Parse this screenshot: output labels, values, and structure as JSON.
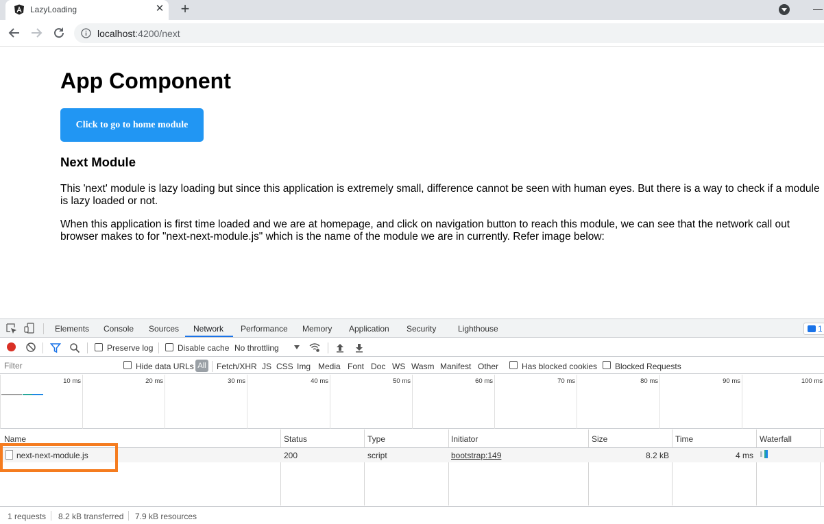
{
  "browser": {
    "tab_title": "LazyLoading",
    "url_host": "localhost",
    "url_rest": ":4200/next"
  },
  "page": {
    "title": "App Component",
    "home_button": "Click to go to home module",
    "section_heading": "Next Module",
    "paragraph_1": "This 'next' module is lazy loading but since this application is extremely small, difference cannot be seen with human eyes. But there is a way to check if a module is lazy loaded or not.",
    "paragraph_2": "When this application is first time loaded and we are at homepage, and click on navigation button to reach this module, we can see that the network call out browser makes to for \"next-next-module.js\" which is the name of the module we are in currently. Refer image below:"
  },
  "devtools": {
    "tabs": [
      "Elements",
      "Console",
      "Sources",
      "Network",
      "Performance",
      "Memory",
      "Application",
      "Security",
      "Lighthouse"
    ],
    "active_tab": "Network",
    "issues_count": "1",
    "controls": {
      "preserve_log": "Preserve log",
      "disable_cache": "Disable cache",
      "throttling": "No throttling"
    },
    "filter": {
      "placeholder": "Filter",
      "hide_data_urls": "Hide data URLs",
      "all": "All",
      "types": [
        "Fetch/XHR",
        "JS",
        "CSS",
        "Img",
        "Media",
        "Font",
        "Doc",
        "WS",
        "Wasm",
        "Manifest",
        "Other"
      ],
      "has_blocked_cookies": "Has blocked cookies",
      "blocked_requests": "Blocked Requests"
    },
    "timeline_labels": [
      "10 ms",
      "20 ms",
      "30 ms",
      "40 ms",
      "50 ms",
      "60 ms",
      "70 ms",
      "80 ms",
      "90 ms",
      "100 ms"
    ],
    "table": {
      "columns": [
        "Name",
        "Status",
        "Type",
        "Initiator",
        "Size",
        "Time",
        "Waterfall"
      ],
      "rows": [
        {
          "name": "next-next-module.js",
          "status": "200",
          "type": "script",
          "initiator": "bootstrap:149",
          "size": "8.2 kB",
          "time": "4 ms"
        }
      ]
    },
    "status_bar": [
      "1 requests",
      "8.2 kB transferred",
      "7.9 kB resources"
    ]
  },
  "colors": {
    "button_blue": "#2196f3",
    "highlight_orange": "#f57c1f",
    "record_red": "#d93025",
    "devtools_accent": "#1a73e8"
  }
}
